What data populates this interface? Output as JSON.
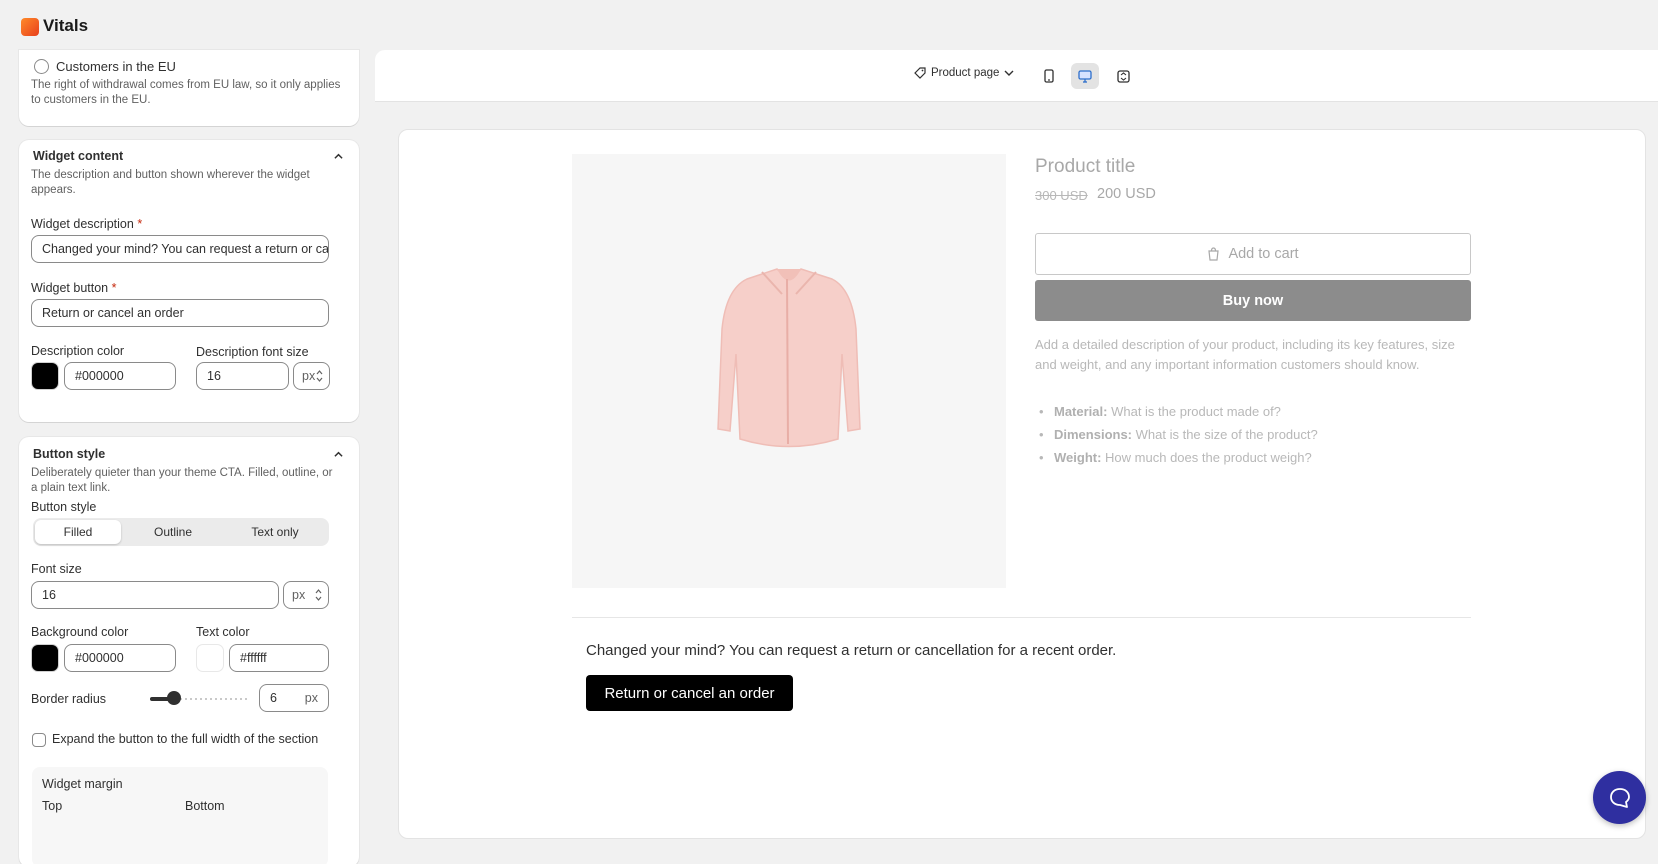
{
  "app": {
    "title": "Vitals"
  },
  "left": {
    "eligibility": {
      "option_label": "Customers in the EU",
      "help": "The right of withdrawal comes from EU law, so it only applies to customers in the EU."
    },
    "widget_content": {
      "title": "Widget content",
      "help": "The description and button shown wherever the widget appears.",
      "description_label": "Widget description",
      "description_value": "Changed your mind? You can request a return or can",
      "button_label": "Widget button",
      "button_value": "Return or cancel an order",
      "desc_color_label": "Description color",
      "desc_color_value": "#000000",
      "desc_font_size_label": "Description font size",
      "desc_font_size_value": "16",
      "unit": "px",
      "required_mark": "*"
    },
    "button_style": {
      "title": "Button style",
      "help": "Deliberately quieter than your theme CTA. Filled, outline, or a plain text link.",
      "style_label": "Button style",
      "options": [
        "Filled",
        "Outline",
        "Text only"
      ],
      "selected": "Filled",
      "font_size_label": "Font size",
      "font_size_value": "16",
      "unit": "px",
      "bg_color_label": "Background color",
      "bg_color_value": "#000000",
      "text_color_label": "Text color",
      "text_color_value": "#ffffff",
      "radius_label": "Border radius",
      "radius_value": "6",
      "radius_unit": "px",
      "full_width_label": "Expand the button to the full width of the section",
      "margin_title": "Widget margin",
      "margin_top_label": "Top",
      "margin_bottom_label": "Bottom"
    }
  },
  "preview": {
    "page_select": "Product page",
    "product": {
      "title": "Product title",
      "old_price": "300 USD",
      "new_price": "200 USD",
      "add_to_cart": "Add to cart",
      "buy_now": "Buy now",
      "description": "Add a detailed description of your product, including its key features, size and weight, and any important information customers should know.",
      "bullets": [
        {
          "key": "Material:",
          "text": "What is the product made of?"
        },
        {
          "key": "Dimensions:",
          "text": "What is the size of the product?"
        },
        {
          "key": "Weight:",
          "text": "How much does the product weigh?"
        }
      ]
    },
    "widget": {
      "description": "Changed your mind? You can request a return or cancellation for a recent order.",
      "button": "Return or cancel an order"
    }
  },
  "colors": {
    "accent": "#2f2fa0",
    "black": "#000000",
    "white": "#ffffff"
  }
}
